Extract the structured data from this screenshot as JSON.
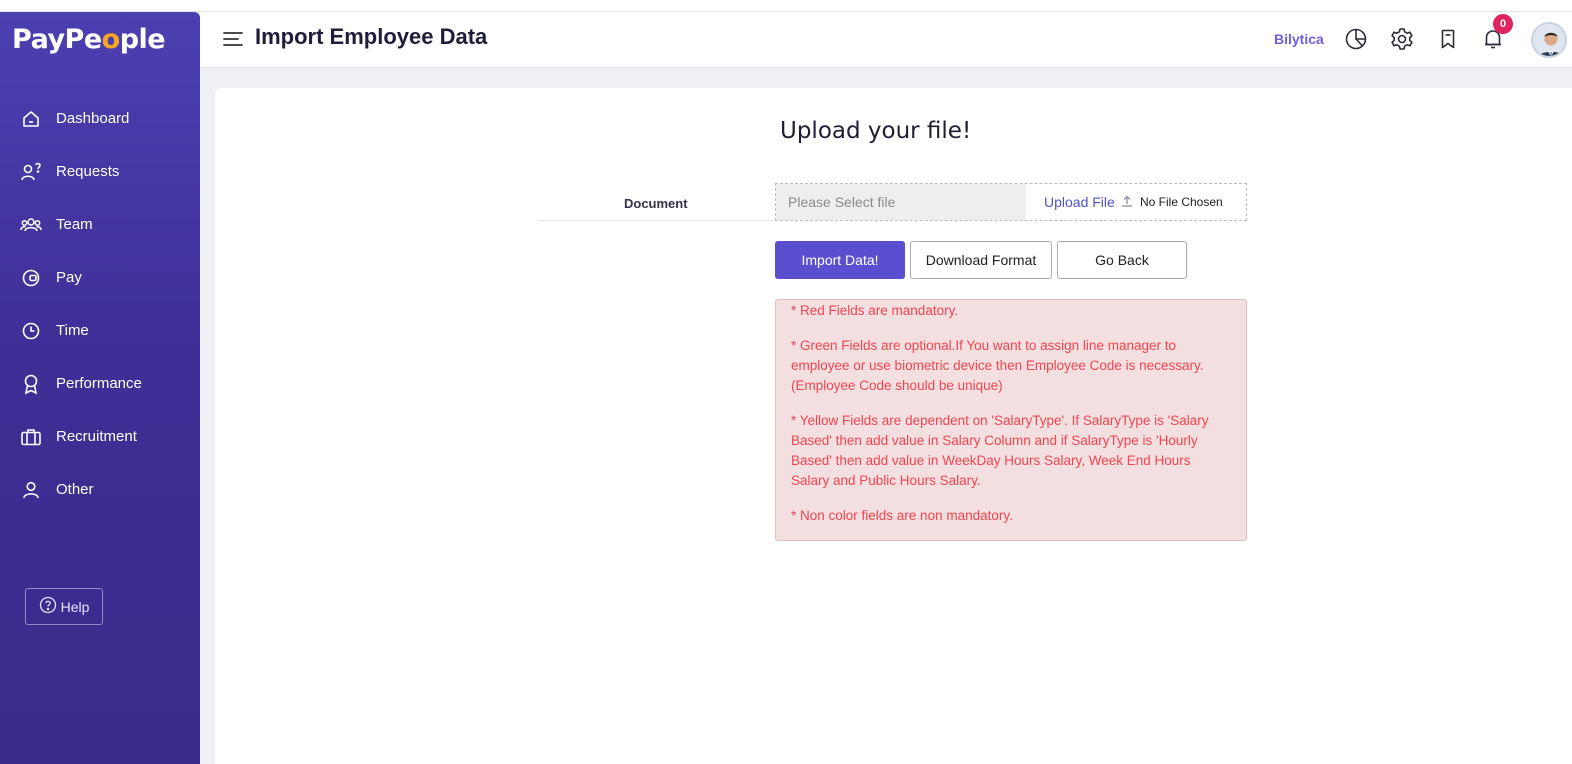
{
  "app": {
    "logo": "PayPeople",
    "logo_parts": [
      "PayPe",
      "o",
      "ple"
    ]
  },
  "sidebar": {
    "items": [
      {
        "label": "Dashboard",
        "icon": "home-icon"
      },
      {
        "label": "Requests",
        "icon": "person-question-icon"
      },
      {
        "label": "Team",
        "icon": "team-icon"
      },
      {
        "label": "Pay",
        "icon": "wallet-icon"
      },
      {
        "label": "Time",
        "icon": "clock-icon"
      },
      {
        "label": "Performance",
        "icon": "award-icon"
      },
      {
        "label": "Recruitment",
        "icon": "briefcase-icon"
      },
      {
        "label": "Other",
        "icon": "user-icon"
      }
    ],
    "help_label": "Help"
  },
  "header": {
    "title": "Import Employee Data",
    "company": "Bilytica",
    "notification_count": "0"
  },
  "upload": {
    "heading": "Upload your file!",
    "document_label": "Document",
    "file_placeholder": "Please Select file",
    "upload_link": "Upload File",
    "no_file": "No File Chosen"
  },
  "actions": {
    "import": "Import Data!",
    "download": "Download Format",
    "back": "Go Back"
  },
  "notes": [
    "* Red Fields are mandatory.",
    "* Green Fields are optional.If You want to assign line manager to employee or use biometric device then Employee Code is necessary.(Employee Code should be unique)",
    "* Yellow Fields are dependent on 'SalaryType'. If SalaryType is 'Salary Based' then add value in Salary Column and if SalaryType is 'Hourly Based' then add value in WeekDay Hours Salary, Week End Hours Salary and Public Hours Salary.",
    "* Non color fields are non mandatory."
  ],
  "colors": {
    "sidebar": "#3e2f97",
    "primary_button": "#5a4fd0",
    "logo_accent": "#f5a623",
    "notice_bg": "#f3dfe0",
    "notice_text": "#f0454f",
    "badge": "#e0245e"
  }
}
